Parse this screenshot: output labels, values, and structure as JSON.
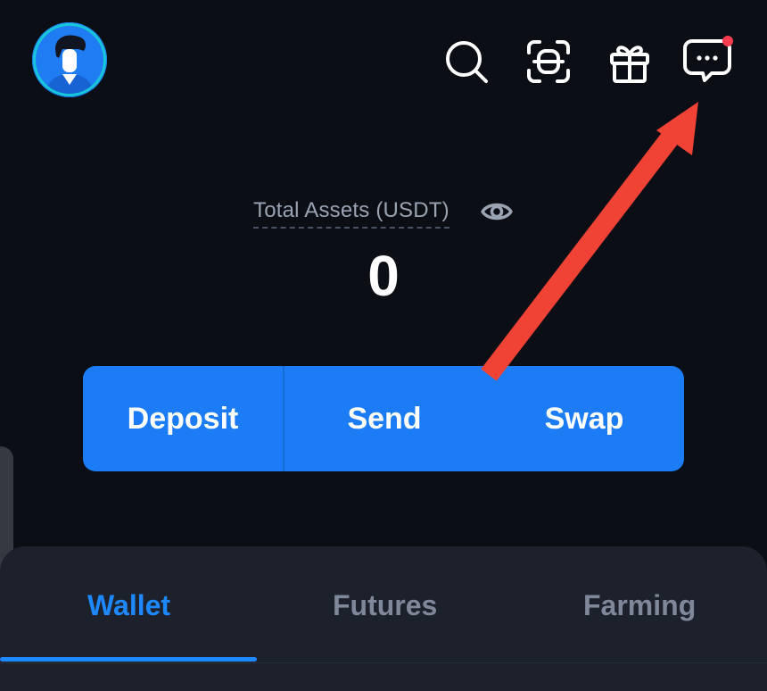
{
  "header": {
    "avatar_icon": "user-avatar-icon",
    "icons": [
      "search-icon",
      "scan-icon",
      "gift-icon",
      "chat-notification-icon"
    ],
    "notification_dot_color": "#ff3b4f"
  },
  "summary": {
    "label": "Total Assets (USDT)",
    "value": "0",
    "eye_icon": "eye-icon"
  },
  "actions": {
    "deposit": "Deposit",
    "send": "Send",
    "swap": "Swap",
    "accent_color": "#1b7cf5"
  },
  "tabs": {
    "wallet": "Wallet",
    "futures": "Futures",
    "farming": "Farming",
    "active": "Wallet"
  },
  "annotation": {
    "arrow_color": "#f04235",
    "target": "chat-notification-icon"
  }
}
